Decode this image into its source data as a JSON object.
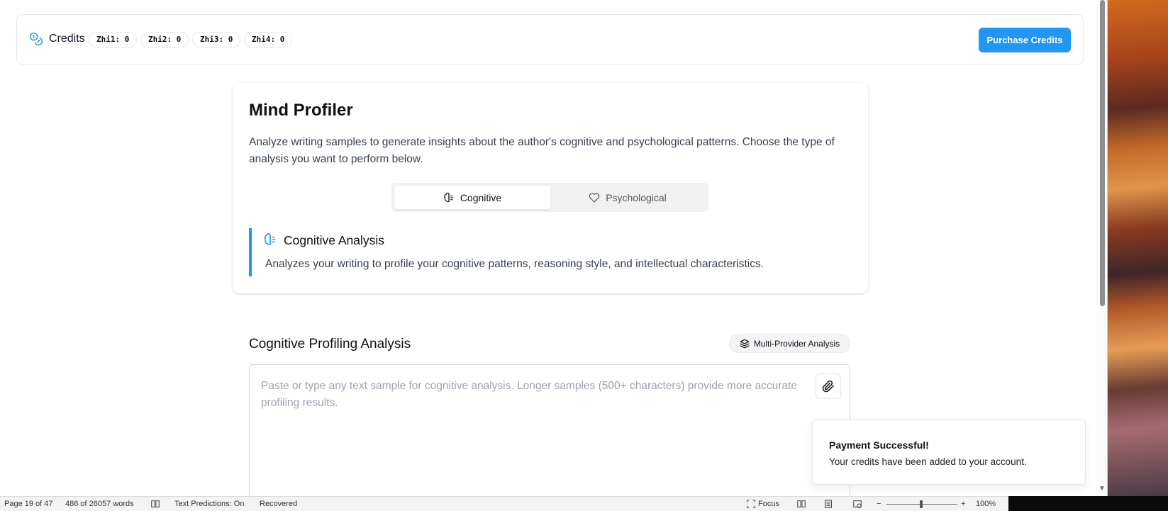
{
  "credits": {
    "label": "Credits",
    "counters": [
      "Zhi1: 0",
      "Zhi2: 0",
      "Zhi3: 0",
      "Zhi4: 0"
    ],
    "purchase_label": "Purchase Credits"
  },
  "profiler": {
    "title": "Mind Profiler",
    "description": "Analyze writing samples to generate insights about the author's cognitive and psychological patterns. Choose the type of analysis you want to perform below.",
    "tabs": [
      {
        "label": "Cognitive",
        "icon": "brain-icon",
        "active": true
      },
      {
        "label": "Psychological",
        "icon": "heart-icon",
        "active": false
      }
    ],
    "analysis": {
      "title": "Cognitive Analysis",
      "description": "Analyzes your writing to profile your cognitive patterns, reasoning style, and intellectual characteristics."
    }
  },
  "input_section": {
    "title": "Cognitive Profiling Analysis",
    "badge": "Multi-Provider Analysis",
    "placeholder": "Paste or type any text sample for cognitive analysis. Longer samples (500+ characters) provide more accurate profiling results."
  },
  "toast": {
    "title": "Payment Successful!",
    "message": "Your credits have been added to your account."
  },
  "statusbar": {
    "page": "Page 19 of 47",
    "words": "486 of 26057 words",
    "predictions": "Text Predictions: On",
    "recovered": "Recovered",
    "focus": "Focus",
    "zoom_minus": "−",
    "zoom_plus": "+",
    "zoom": "100%"
  },
  "colors": {
    "accent": "#2196f3",
    "border": "#e5e7eb"
  }
}
